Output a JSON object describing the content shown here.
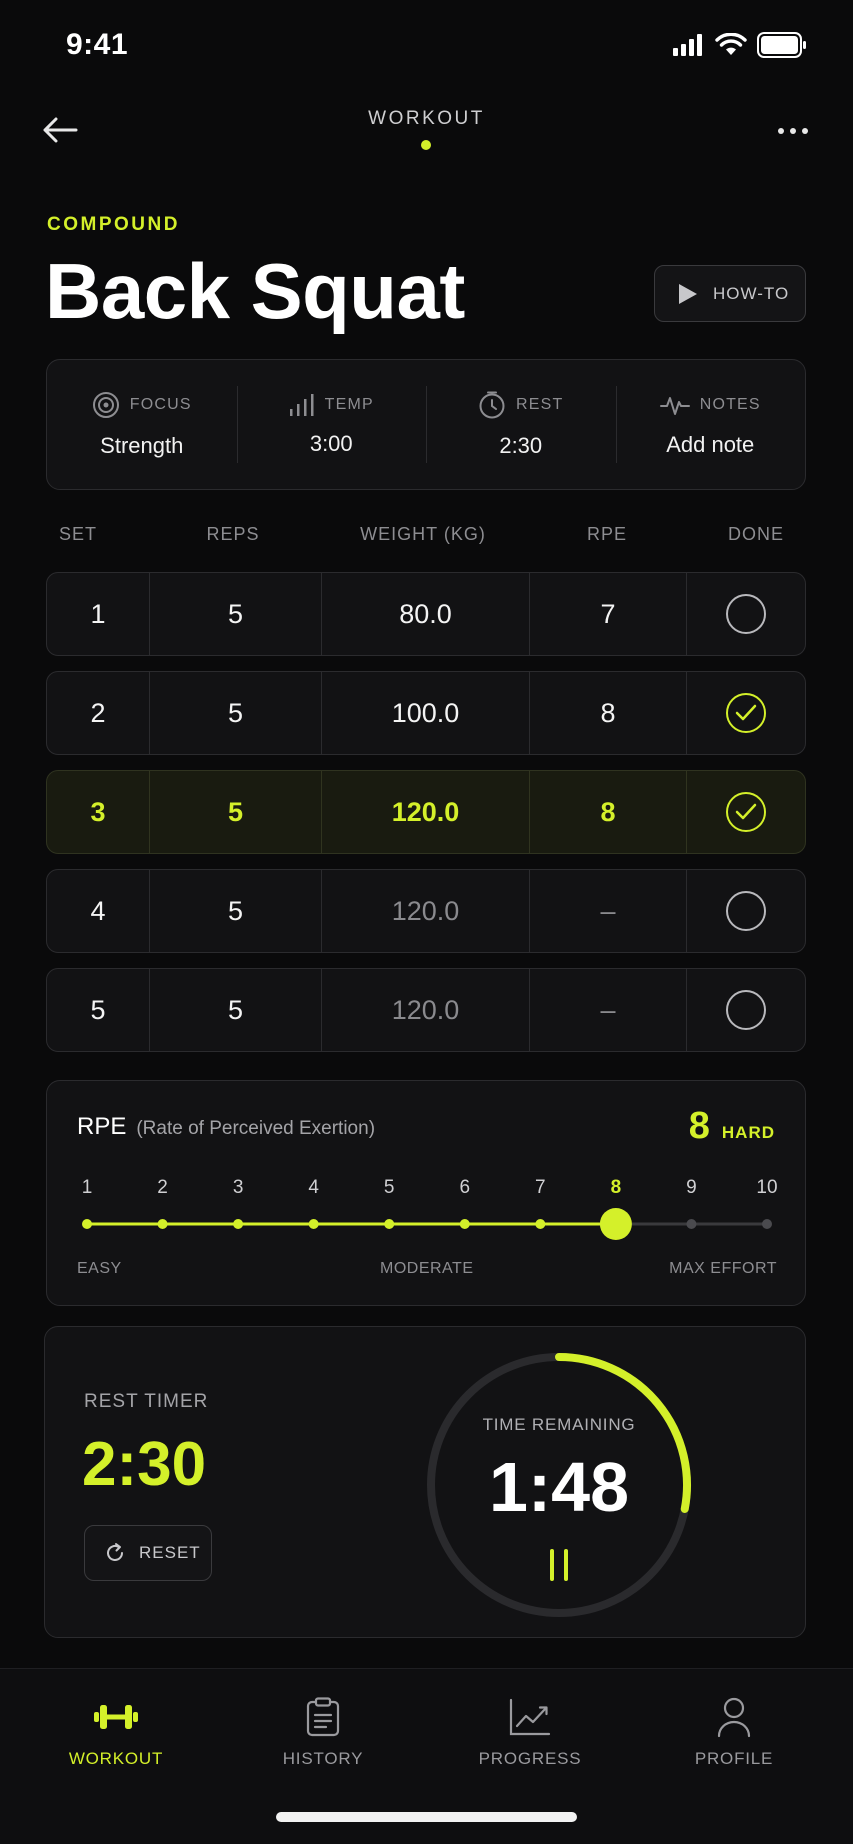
{
  "status_bar": {
    "time": "9:41"
  },
  "header": {
    "title": "WORKOUT"
  },
  "exercise": {
    "category": "COMPOUND",
    "name": "Back Squat",
    "howto_label": "HOW-TO"
  },
  "info": [
    {
      "label": "FOCUS",
      "value": "Strength",
      "icon": "target-icon"
    },
    {
      "label": "TEMP",
      "value": "3:00",
      "icon": "bars-icon"
    },
    {
      "label": "REST",
      "value": "2:30",
      "icon": "clock-icon"
    },
    {
      "label": "NOTES",
      "value": "Add note",
      "icon": "pulse-icon"
    }
  ],
  "set_table": {
    "headers": [
      "SET",
      "REPS",
      "WEIGHT (KG)",
      "RPE",
      "DONE"
    ],
    "rows": [
      {
        "set": "1",
        "reps": "5",
        "weight": "80.0",
        "rpe": "7",
        "done": false
      },
      {
        "set": "2",
        "reps": "5",
        "weight": "100.0",
        "rpe": "8",
        "done": true
      },
      {
        "set": "3",
        "reps": "5",
        "weight": "120.0",
        "rpe": "8",
        "done": true
      },
      {
        "set": "4",
        "reps": "5",
        "weight": "120.0",
        "rpe": "–",
        "done": false
      },
      {
        "set": "5",
        "reps": "5",
        "weight": "120.0",
        "rpe": "–",
        "done": false
      }
    ],
    "active_set": 3
  },
  "rpe": {
    "title": "RPE",
    "subtitle": "(Rate of Perceived Exertion)",
    "value": "8",
    "level": "HARD",
    "scale": [
      "1",
      "2",
      "3",
      "4",
      "5",
      "6",
      "7",
      "8",
      "9",
      "10"
    ],
    "selected": 8,
    "labels": {
      "low": "EASY",
      "mid": "MODERATE",
      "high": "MAX EFFORT"
    }
  },
  "timer": {
    "label": "REST TIMER",
    "duration": "2:30",
    "reset_label": "RESET",
    "remaining_label": "TIME REMAINING",
    "remaining": "1:48",
    "progress": 0.28
  },
  "tabs": [
    {
      "label": "WORKOUT",
      "icon": "dumbbell-icon",
      "active": true
    },
    {
      "label": "HISTORY",
      "icon": "clipboard-icon",
      "active": false
    },
    {
      "label": "PROGRESS",
      "icon": "chart-icon",
      "active": false
    },
    {
      "label": "PROFILE",
      "icon": "person-icon",
      "active": false
    }
  ],
  "colors": {
    "accent": "#d4f02a",
    "background": "#0a0a0b",
    "card": "#121214",
    "border": "#2b2b2e"
  }
}
